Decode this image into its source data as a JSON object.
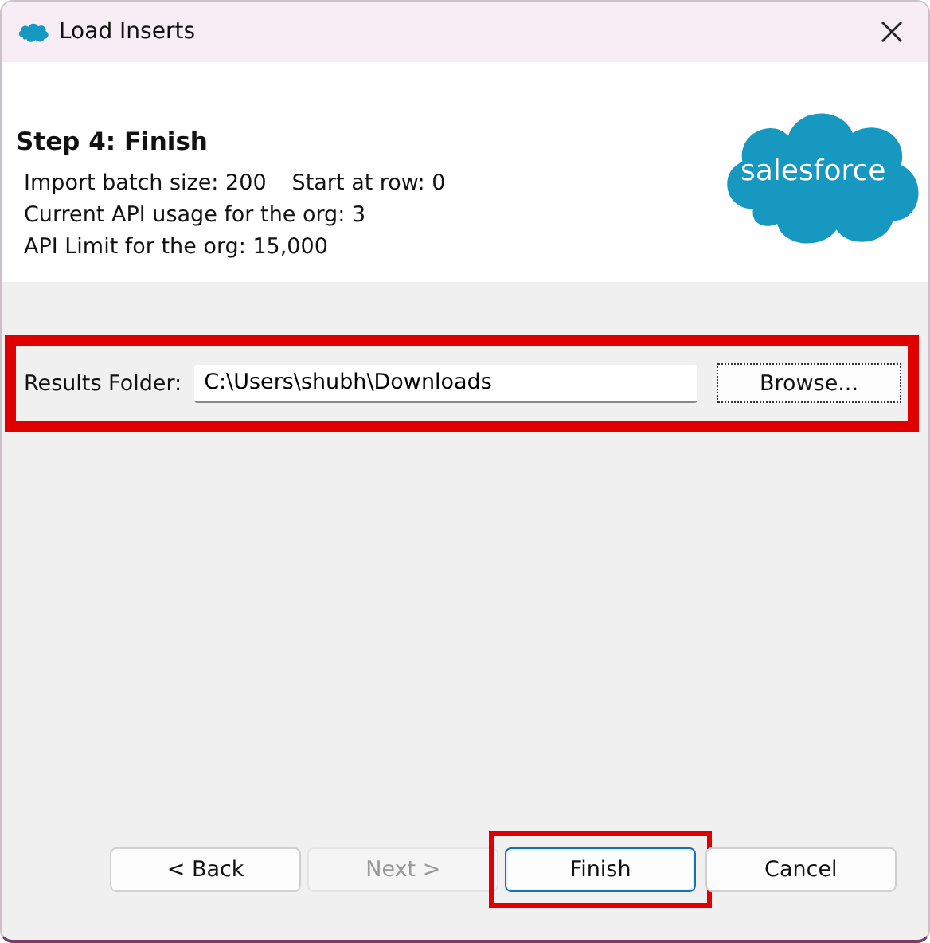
{
  "window": {
    "title": "Load Inserts"
  },
  "header": {
    "step_title": "Step 4: Finish",
    "info_lines": [
      [
        "Import batch size: 200",
        "Start at row: 0"
      ],
      [
        "Current API usage for the org: 3"
      ],
      [
        "API Limit for the org: 15,000"
      ]
    ],
    "logo_text": "salesforce"
  },
  "results_folder": {
    "label": "Results Folder:",
    "value": "C:\\Users\\shubh\\Downloads",
    "button": "Browse...",
    "highlighted": true
  },
  "buttons": [
    {
      "label": "< Back",
      "disabled": false,
      "default": false,
      "highlighted": false
    },
    {
      "label": "Next >",
      "disabled": true,
      "default": false,
      "highlighted": false
    },
    {
      "label": "Finish",
      "disabled": false,
      "default": true,
      "highlighted": true
    },
    {
      "label": "Cancel",
      "disabled": false,
      "default": false,
      "highlighted": false
    }
  ]
}
